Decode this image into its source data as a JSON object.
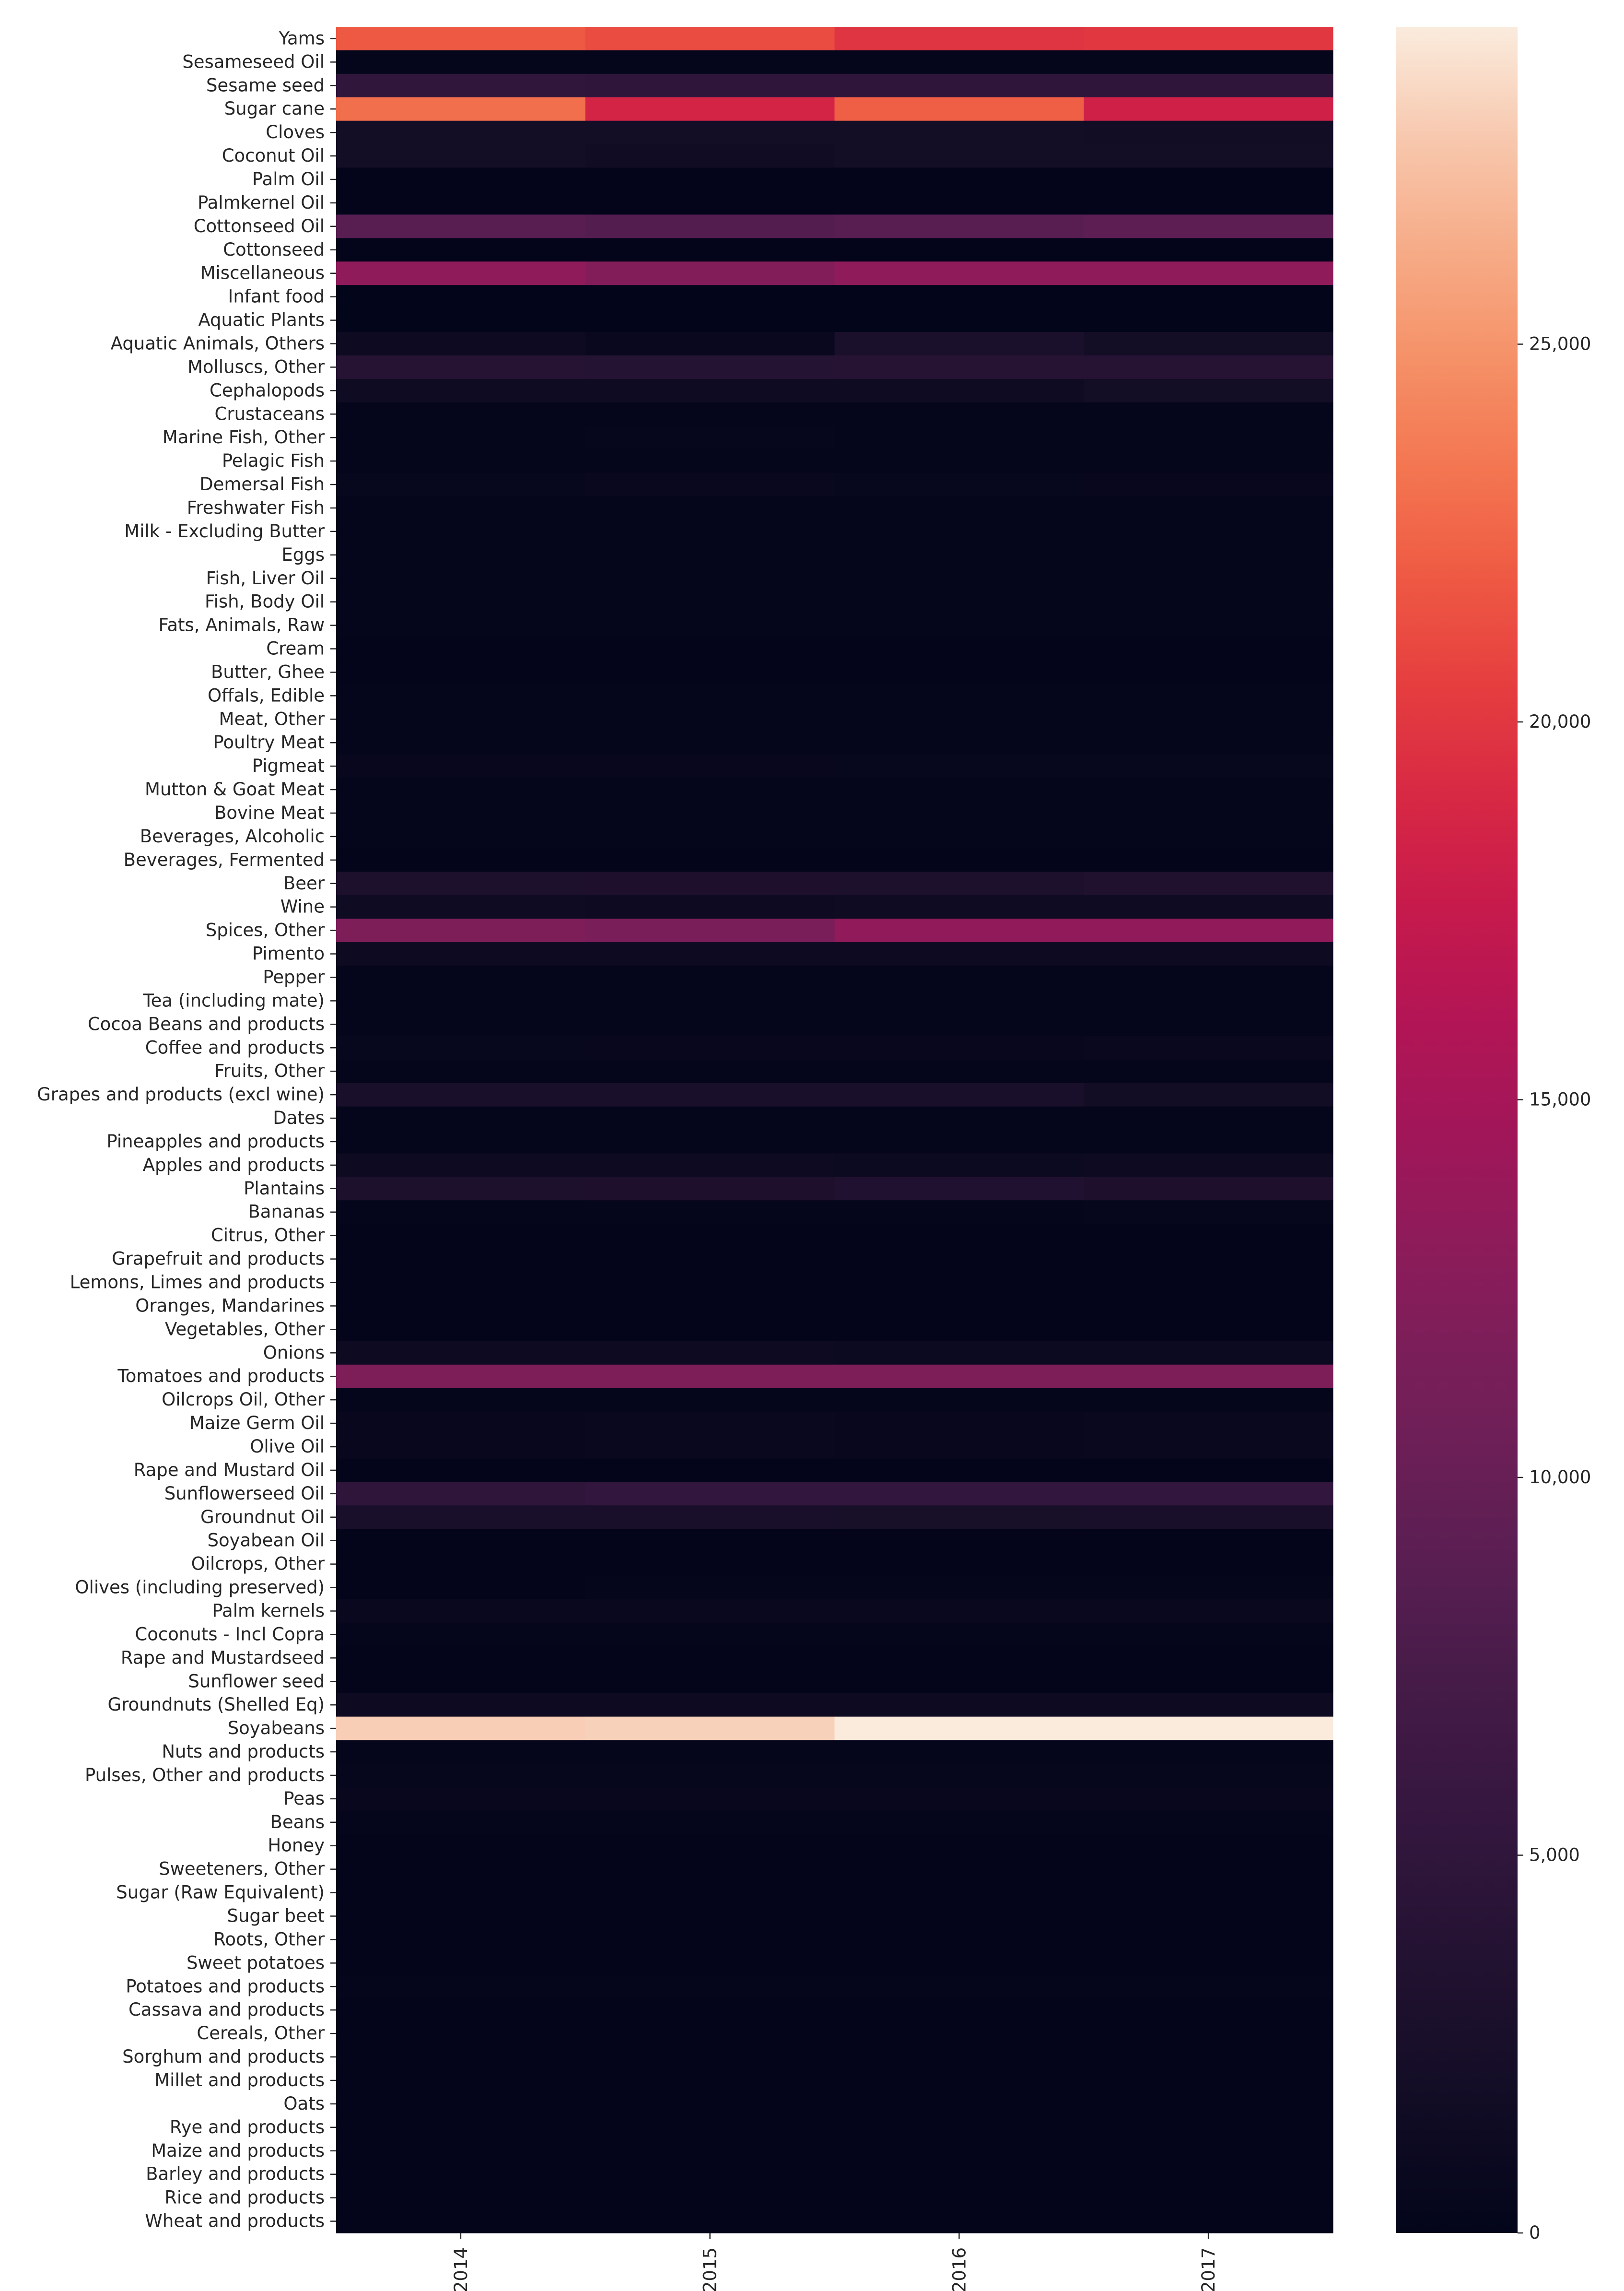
{
  "chart_data": {
    "type": "heatmap",
    "title": "",
    "xlabel": "",
    "ylabel": "",
    "colormap": "rocket",
    "color_range": [
      0,
      29200
    ],
    "colorbar": {
      "ticks": [
        0,
        5000,
        10000,
        15000,
        20000,
        25000
      ],
      "tick_labels": [
        "0",
        "5,000",
        "10,000",
        "15,000",
        "20,000",
        "25,000"
      ],
      "placement": "right"
    },
    "x": [
      "2014",
      "2015",
      "2016",
      "2017"
    ],
    "rows": [
      {
        "label": "Yams",
        "values": [
          21900,
          21200,
          19800,
          20000
        ]
      },
      {
        "label": "Sesameseed Oil",
        "values": [
          300,
          300,
          300,
          300
        ]
      },
      {
        "label": "Sesame seed",
        "values": [
          5200,
          5000,
          5100,
          5000
        ]
      },
      {
        "label": "Sugar cane",
        "values": [
          23000,
          18600,
          22200,
          18300
        ]
      },
      {
        "label": "Cloves",
        "values": [
          2000,
          2000,
          2000,
          1800
        ]
      },
      {
        "label": "Coconut Oil",
        "values": [
          2000,
          1700,
          1900,
          2000
        ]
      },
      {
        "label": "Palm Oil",
        "values": [
          100,
          100,
          100,
          100
        ]
      },
      {
        "label": "Palmkernel Oil",
        "values": [
          100,
          100,
          100,
          100
        ]
      },
      {
        "label": "Cottonseed Oil",
        "values": [
          8800,
          8400,
          8800,
          9200
        ]
      },
      {
        "label": "Cottonseed",
        "values": [
          100,
          100,
          100,
          100
        ]
      },
      {
        "label": "Miscellaneous",
        "values": [
          13200,
          12300,
          13200,
          13200
        ]
      },
      {
        "label": "Infant food",
        "values": [
          50,
          50,
          50,
          50
        ]
      },
      {
        "label": "Aquatic Plants",
        "values": [
          50,
          50,
          50,
          50
        ]
      },
      {
        "label": "Aquatic Animals, Others",
        "values": [
          1200,
          800,
          2800,
          1900
        ]
      },
      {
        "label": "Molluscs, Other",
        "values": [
          4000,
          3900,
          4000,
          4000
        ]
      },
      {
        "label": "Cephalopods",
        "values": [
          1500,
          1500,
          1500,
          1900
        ]
      },
      {
        "label": "Crustaceans",
        "values": [
          200,
          200,
          200,
          200
        ]
      },
      {
        "label": "Marine Fish, Other",
        "values": [
          300,
          400,
          300,
          300
        ]
      },
      {
        "label": "Pelagic Fish",
        "values": [
          300,
          300,
          200,
          300
        ]
      },
      {
        "label": "Demersal Fish",
        "values": [
          500,
          800,
          500,
          600
        ]
      },
      {
        "label": "Freshwater Fish",
        "values": [
          200,
          200,
          200,
          200
        ]
      },
      {
        "label": "Milk - Excluding Butter",
        "values": [
          200,
          200,
          200,
          200
        ]
      },
      {
        "label": "Eggs",
        "values": [
          200,
          200,
          200,
          200
        ]
      },
      {
        "label": "Fish, Liver Oil",
        "values": [
          200,
          200,
          200,
          300
        ]
      },
      {
        "label": "Fish, Body Oil",
        "values": [
          200,
          200,
          200,
          300
        ]
      },
      {
        "label": "Fats, Animals, Raw",
        "values": [
          200,
          200,
          200,
          200
        ]
      },
      {
        "label": "Cream",
        "values": [
          100,
          100,
          100,
          100
        ]
      },
      {
        "label": "Butter, Ghee",
        "values": [
          100,
          100,
          100,
          100
        ]
      },
      {
        "label": "Offals, Edible",
        "values": [
          200,
          200,
          200,
          200
        ]
      },
      {
        "label": "Meat, Other",
        "values": [
          200,
          200,
          200,
          200
        ]
      },
      {
        "label": "Poultry Meat",
        "values": [
          300,
          300,
          300,
          300
        ]
      },
      {
        "label": "Pigmeat",
        "values": [
          600,
          600,
          500,
          500
        ]
      },
      {
        "label": "Mutton & Goat Meat",
        "values": [
          300,
          300,
          300,
          300
        ]
      },
      {
        "label": "Bovine Meat",
        "values": [
          300,
          300,
          300,
          300
        ]
      },
      {
        "label": "Beverages, Alcoholic",
        "values": [
          200,
          200,
          200,
          200
        ]
      },
      {
        "label": "Beverages, Fermented",
        "values": [
          100,
          100,
          100,
          100
        ]
      },
      {
        "label": "Beer",
        "values": [
          3000,
          3100,
          3000,
          3300
        ]
      },
      {
        "label": "Wine",
        "values": [
          1500,
          1200,
          1500,
          1500
        ]
      },
      {
        "label": "Spices, Other",
        "values": [
          11800,
          11600,
          13300,
          13300
        ]
      },
      {
        "label": "Pimento",
        "values": [
          1200,
          1200,
          1200,
          1200
        ]
      },
      {
        "label": "Pepper",
        "values": [
          200,
          200,
          200,
          200
        ]
      },
      {
        "label": "Tea (including mate)",
        "values": [
          200,
          200,
          200,
          200
        ]
      },
      {
        "label": "Cocoa Beans and products",
        "values": [
          200,
          200,
          200,
          200
        ]
      },
      {
        "label": "Coffee and products",
        "values": [
          500,
          600,
          600,
          800
        ]
      },
      {
        "label": "Fruits, Other",
        "values": [
          200,
          200,
          200,
          200
        ]
      },
      {
        "label": "Grapes and products (excl wine)",
        "values": [
          2600,
          2600,
          2600,
          1800
        ]
      },
      {
        "label": "Dates",
        "values": [
          200,
          200,
          200,
          200
        ]
      },
      {
        "label": "Pineapples and products",
        "values": [
          200,
          200,
          200,
          200
        ]
      },
      {
        "label": "Apples and products",
        "values": [
          1200,
          1200,
          1100,
          1200
        ]
      },
      {
        "label": "Plantains",
        "values": [
          2900,
          3100,
          3400,
          3100
        ]
      },
      {
        "label": "Bananas",
        "values": [
          300,
          300,
          300,
          400
        ]
      },
      {
        "label": "Citrus, Other",
        "values": [
          100,
          100,
          100,
          100
        ]
      },
      {
        "label": "Grapefruit and products",
        "values": [
          100,
          100,
          100,
          100
        ]
      },
      {
        "label": "Lemons, Limes and products",
        "values": [
          100,
          100,
          100,
          100
        ]
      },
      {
        "label": "Oranges, Mandarines",
        "values": [
          100,
          100,
          100,
          100
        ]
      },
      {
        "label": "Vegetables, Other",
        "values": [
          100,
          100,
          100,
          100
        ]
      },
      {
        "label": "Onions",
        "values": [
          1200,
          1200,
          1100,
          1100
        ]
      },
      {
        "label": "Tomatoes and products",
        "values": [
          11800,
          11800,
          11800,
          11800
        ]
      },
      {
        "label": "Oilcrops Oil, Other",
        "values": [
          300,
          300,
          300,
          300
        ]
      },
      {
        "label": "Maize Germ Oil",
        "values": [
          600,
          700,
          600,
          800
        ]
      },
      {
        "label": "Olive Oil",
        "values": [
          600,
          700,
          600,
          800
        ]
      },
      {
        "label": "Rape and Mustard Oil",
        "values": [
          100,
          100,
          100,
          100
        ]
      },
      {
        "label": "Sunflowerseed Oil",
        "values": [
          5000,
          5300,
          5300,
          5300
        ]
      },
      {
        "label": "Groundnut Oil",
        "values": [
          2600,
          2600,
          2500,
          2600
        ]
      },
      {
        "label": "Soyabean Oil",
        "values": [
          100,
          100,
          100,
          100
        ]
      },
      {
        "label": "Oilcrops, Other",
        "values": [
          100,
          100,
          100,
          100
        ]
      },
      {
        "label": "Olives (including preserved)",
        "values": [
          100,
          300,
          300,
          300
        ]
      },
      {
        "label": "Palm kernels",
        "values": [
          700,
          700,
          700,
          700
        ]
      },
      {
        "label": "Coconuts - Incl Copra",
        "values": [
          200,
          200,
          200,
          200
        ]
      },
      {
        "label": "Rape and Mustardseed",
        "values": [
          100,
          100,
          100,
          100
        ]
      },
      {
        "label": "Sunflower seed",
        "values": [
          100,
          100,
          100,
          100
        ]
      },
      {
        "label": "Groundnuts (Shelled Eq)",
        "values": [
          1200,
          1200,
          1200,
          1200
        ]
      },
      {
        "label": "Soyabeans",
        "values": [
          28000,
          28100,
          29200,
          29200
        ]
      },
      {
        "label": "Nuts and products",
        "values": [
          300,
          300,
          300,
          300
        ]
      },
      {
        "label": "Pulses, Other and products",
        "values": [
          400,
          400,
          400,
          400
        ]
      },
      {
        "label": "Peas",
        "values": [
          600,
          600,
          600,
          600
        ]
      },
      {
        "label": "Beans",
        "values": [
          200,
          200,
          200,
          200
        ]
      },
      {
        "label": "Honey",
        "values": [
          100,
          100,
          100,
          100
        ]
      },
      {
        "label": "Sweeteners, Other",
        "values": [
          100,
          100,
          100,
          100
        ]
      },
      {
        "label": "Sugar (Raw Equivalent)",
        "values": [
          100,
          100,
          100,
          100
        ]
      },
      {
        "label": "Sugar beet",
        "values": [
          100,
          100,
          100,
          100
        ]
      },
      {
        "label": "Roots, Other",
        "values": [
          100,
          100,
          100,
          100
        ]
      },
      {
        "label": "Sweet potatoes",
        "values": [
          100,
          100,
          100,
          100
        ]
      },
      {
        "label": "Potatoes and products",
        "values": [
          200,
          200,
          200,
          200
        ]
      },
      {
        "label": "Cassava and products",
        "values": [
          100,
          100,
          100,
          100
        ]
      },
      {
        "label": "Cereals, Other",
        "values": [
          100,
          100,
          100,
          100
        ]
      },
      {
        "label": "Sorghum and products",
        "values": [
          100,
          100,
          100,
          100
        ]
      },
      {
        "label": "Millet and products",
        "values": [
          100,
          100,
          100,
          100
        ]
      },
      {
        "label": "Oats",
        "values": [
          100,
          100,
          100,
          100
        ]
      },
      {
        "label": "Rye and products",
        "values": [
          100,
          100,
          100,
          100
        ]
      },
      {
        "label": "Maize and products",
        "values": [
          100,
          100,
          100,
          100
        ]
      },
      {
        "label": "Barley and products",
        "values": [
          100,
          100,
          100,
          100
        ]
      },
      {
        "label": "Rice and products",
        "values": [
          100,
          100,
          100,
          100
        ]
      },
      {
        "label": "Wheat and products",
        "values": [
          100,
          100,
          100,
          100
        ]
      }
    ]
  }
}
